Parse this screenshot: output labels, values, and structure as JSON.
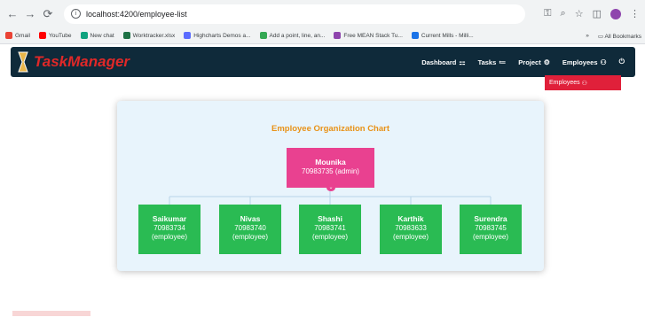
{
  "browser": {
    "url": "localhost:4200/employee-list",
    "bookmarks": [
      {
        "label": "Gmail",
        "color": "#ea4335"
      },
      {
        "label": "YouTube",
        "color": "#ff0000"
      },
      {
        "label": "New chat",
        "color": "#10a37f"
      },
      {
        "label": "Worktracker.xlsx",
        "color": "#1e7145"
      },
      {
        "label": "Highcharts Demos a...",
        "color": "#5b6cff"
      },
      {
        "label": "Add a point, line, an...",
        "color": "#34a853"
      },
      {
        "label": "Free MEAN Stack Tu...",
        "color": "#8e44ad"
      },
      {
        "label": "Current Mills - Milli...",
        "color": "#1a73e8"
      }
    ],
    "more_label": "»",
    "all_bookmarks": "All Bookmarks"
  },
  "app": {
    "brand": "TaskManager",
    "nav": {
      "dashboard": "Dashboard",
      "tasks": "Tasks",
      "project": "Project",
      "employees": "Employees"
    },
    "dropdown_item": "Employees"
  },
  "chart": {
    "title": "Employee Organization Chart",
    "admin": {
      "name": "Mounika",
      "detail": "70983735 (admin)"
    },
    "employees": [
      {
        "name": "Saikumar",
        "id": "70983734",
        "role": "(employee)"
      },
      {
        "name": "Nivas",
        "id": "70983740",
        "role": "(employee)"
      },
      {
        "name": "Shashi",
        "id": "70983741",
        "role": "(employee)"
      },
      {
        "name": "Karthik",
        "id": "70983633",
        "role": "(employee)"
      },
      {
        "name": "Surendra",
        "id": "70983745",
        "role": "(employee)"
      }
    ]
  },
  "colors": {
    "navbar": "#0f2a3a",
    "brand": "#e02828",
    "admin_node": "#e94190",
    "employee_node": "#2abb53",
    "title": "#e89218",
    "dropdown": "#e0203a"
  }
}
